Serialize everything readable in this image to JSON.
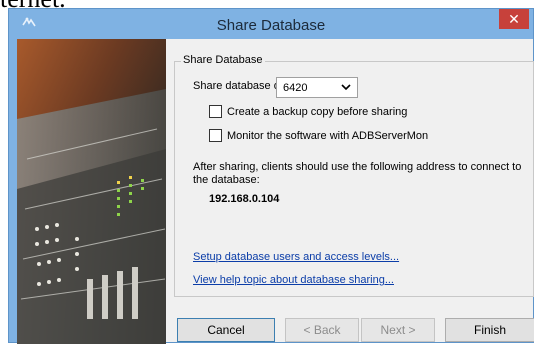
{
  "document": {
    "fragment": "ternet."
  },
  "window": {
    "title": "Share Database",
    "close_glyph": "✕"
  },
  "group": {
    "legend": "Share Database",
    "port_label": "Share database on port:",
    "port_value": "6420",
    "backup_label": "Create a backup copy before sharing",
    "backup_checked": false,
    "monitor_label": "Monitor the software with ADBServerMon",
    "monitor_checked": false,
    "info_line1": "After sharing, clients should use the following address to connect to",
    "info_line2": "the database:",
    "address": "192.168.0.104",
    "setup_link": "Setup database users and access levels...",
    "help_link": "View help topic about database sharing..."
  },
  "buttons": {
    "cancel": "Cancel",
    "back": "< Back",
    "next": "Next >",
    "finish": "Finish"
  },
  "colors": {
    "titlebar": "#7fb2e3",
    "close": "#c7413b",
    "link": "#0b3da8",
    "dialog_bg": "#f0f0f0"
  },
  "icons": [
    "app-icon",
    "close-icon",
    "chevron-down-icon",
    "mixing-console-image"
  ]
}
